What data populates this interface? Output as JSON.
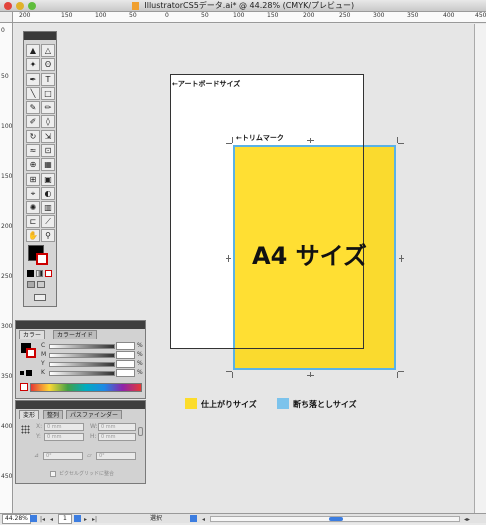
{
  "window": {
    "title": "IllustratorCS5データ.ai* @ 44.28% (CMYK/プレビュー)"
  },
  "ruler": {
    "top_labels": [
      "200",
      "150",
      "100",
      "50",
      "0",
      "50",
      "100",
      "150",
      "200",
      "250",
      "300",
      "350",
      "400",
      "450"
    ],
    "left_labels": [
      "0",
      "50",
      "100",
      "150",
      "200",
      "250",
      "300",
      "350",
      "400",
      "450"
    ]
  },
  "canvas": {
    "artboard_label": "←アートボードサイズ",
    "trim_label": "←トリムマーク",
    "a4_label": "A4 サイズ",
    "legend": {
      "finish_label": "仕上がりサイズ",
      "bleed_label": "断ち落としサイズ",
      "finish_color": "#fcdc2b",
      "bleed_color": "#7cc3ec"
    }
  },
  "color_panel": {
    "tabs": [
      "カラー",
      "カラーガイド"
    ],
    "channels": [
      "C",
      "M",
      "Y",
      "K"
    ],
    "percent_sign": "%"
  },
  "transform_panel": {
    "tabs": [
      "変形",
      "整列",
      "パスファインダー"
    ],
    "x_label": "X:",
    "x_value": "0 mm",
    "y_label": "Y:",
    "y_value": "0 mm",
    "w_label": "W:",
    "w_value": "0 mm",
    "h_label": "H:",
    "h_value": "0 mm",
    "angle_value": "0°",
    "shear_value": "0°",
    "pixel_grid_label": "ピクセルグリッドに整合"
  },
  "status": {
    "zoom": "44.28%",
    "page": "1",
    "mode": "選択"
  },
  "colors": {
    "accent_blue": "#5ab2e6",
    "yellow": "#fcdc2b"
  }
}
